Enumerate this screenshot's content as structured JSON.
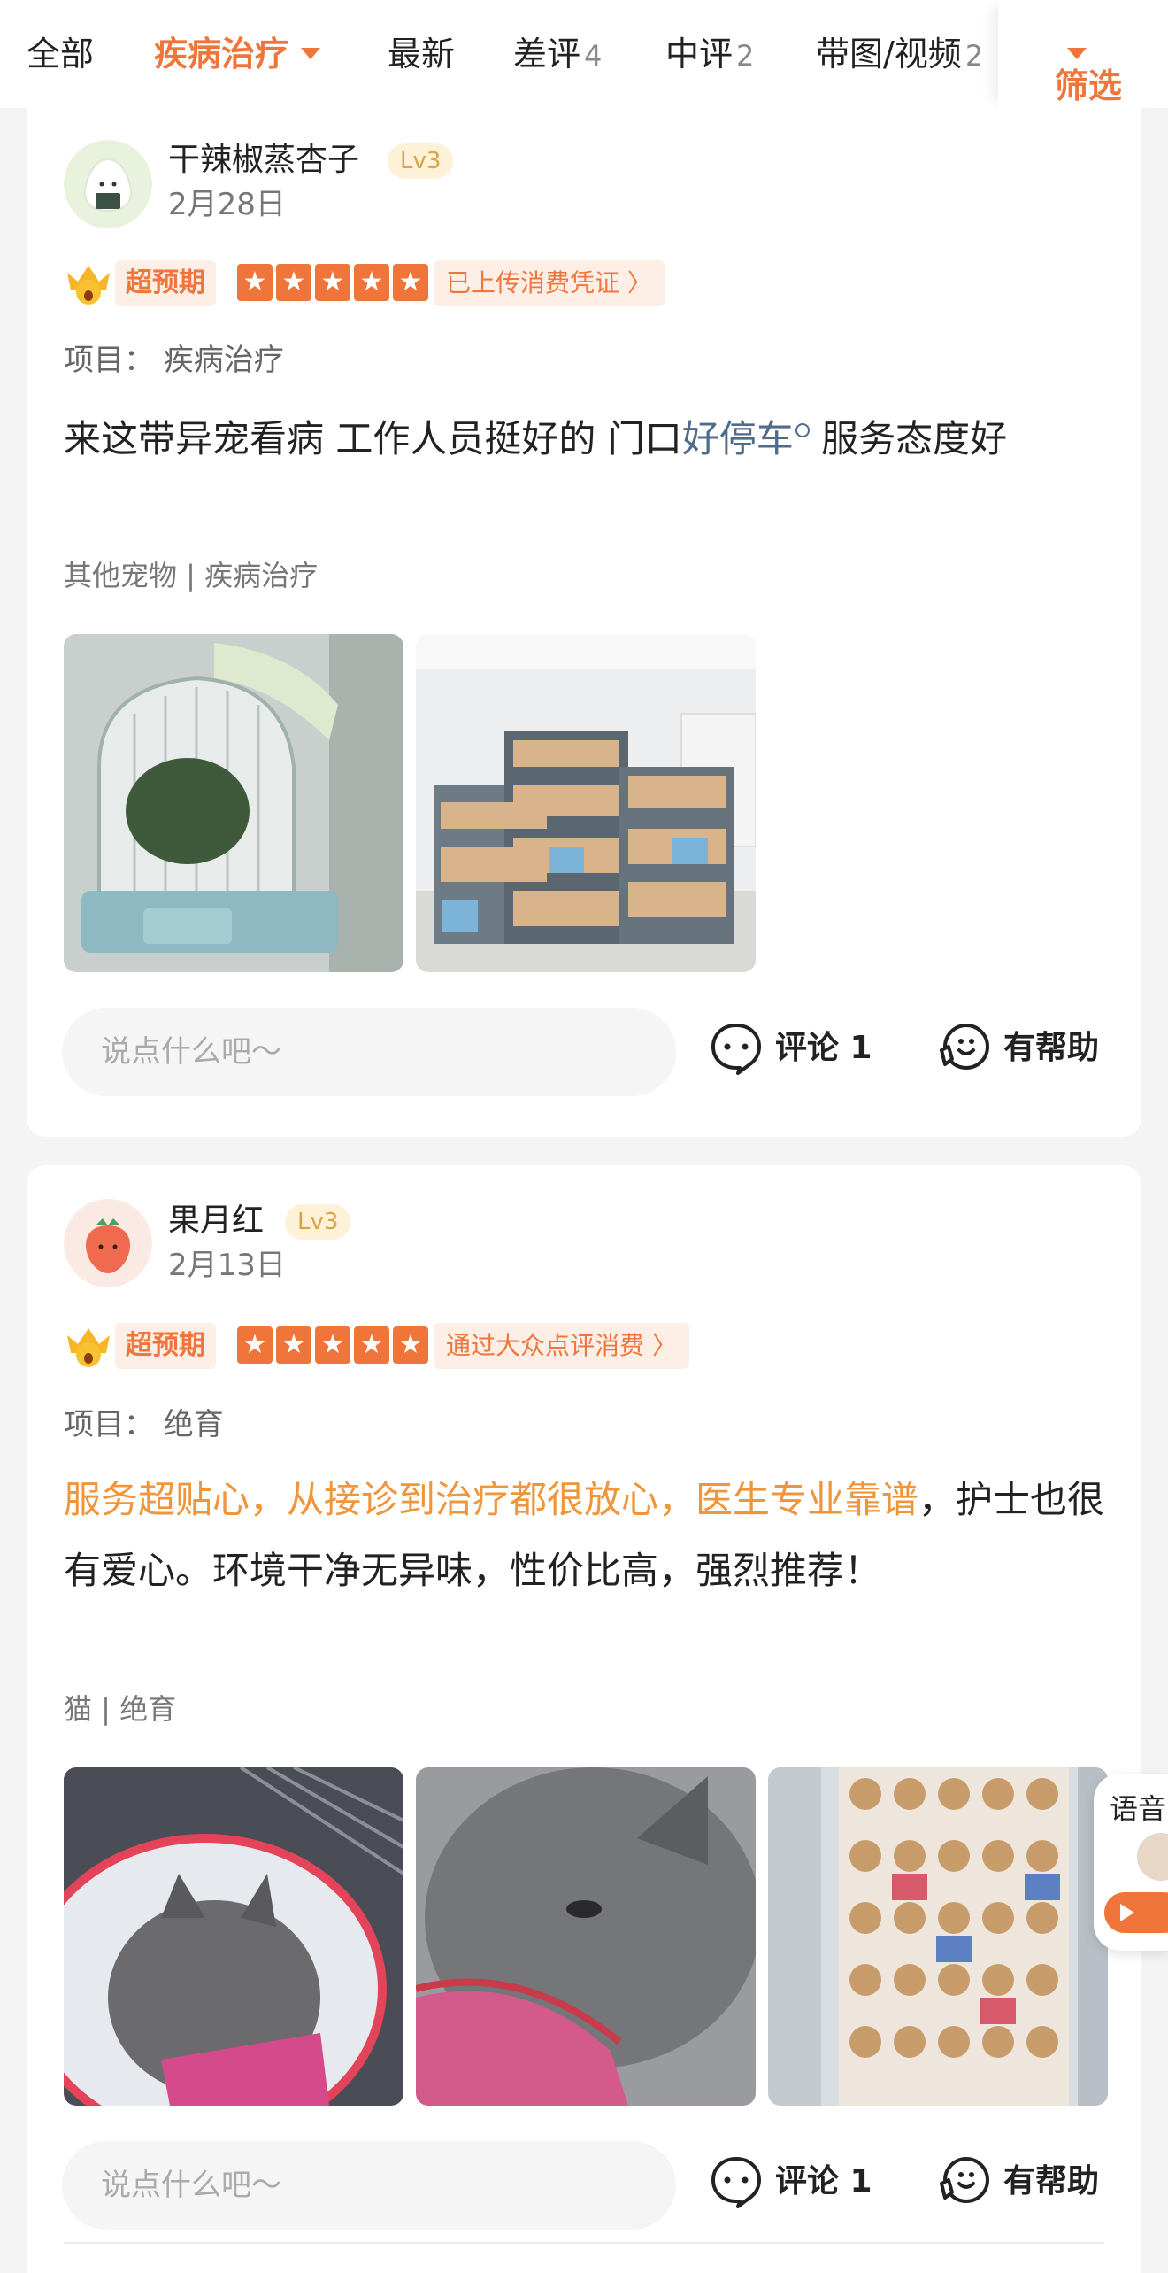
{
  "tabs": [
    {
      "label": "全部",
      "count": ""
    },
    {
      "label": "疾病治疗",
      "count": ""
    },
    {
      "label": "最新",
      "count": ""
    },
    {
      "label": "差评",
      "count": "4"
    },
    {
      "label": "中评",
      "count": "2"
    },
    {
      "label": "带图/视频",
      "count": "2"
    }
  ],
  "filter_label": "筛选",
  "colors": {
    "accent": "#f0753a",
    "keyword": "#516b8c",
    "highlight": "#f0953a"
  },
  "reviews": [
    {
      "username": "干辣椒蒸杏子",
      "level": "Lv3",
      "date": "2月28日",
      "badge": "超预期",
      "stars": 5,
      "voucher": "已上传消费凭证 〉",
      "project": "项目：  疾病治疗",
      "content_parts": [
        "来这带异宠看病 工作人员挺好的 门口",
        "好停车",
        " 服务态度好"
      ],
      "tags": "其他宠物 | 疾病治疗",
      "photos": [
        "hamster-cage-photo",
        "pet-shop-shelf-photo"
      ],
      "comment_placeholder": "说点什么吧～",
      "comment_label": "评论 1",
      "helpful_label": "有帮助"
    },
    {
      "username": "果月红",
      "level": "Lv3",
      "date": "2月13日",
      "badge": "超预期",
      "stars": 5,
      "voucher": "通过大众点评消费 〉",
      "project": "项目：  绝育",
      "content_parts": [
        "服务超贴心，从接诊到治疗都很放心，医生专业靠谱",
        "，护士也很有爱心。环境干净无异味，性价比高，强烈推荐！"
      ],
      "tags": "猫 | 绝育",
      "photos": [
        "cat-in-cone-photo",
        "cat-closeup-photo",
        "pet-poster-wall-photo"
      ],
      "comment_placeholder": "说点什么吧～",
      "comment_label": "评论 1",
      "helpful_label": "有帮助"
    }
  ],
  "voice_widget": {
    "label": "语音"
  }
}
